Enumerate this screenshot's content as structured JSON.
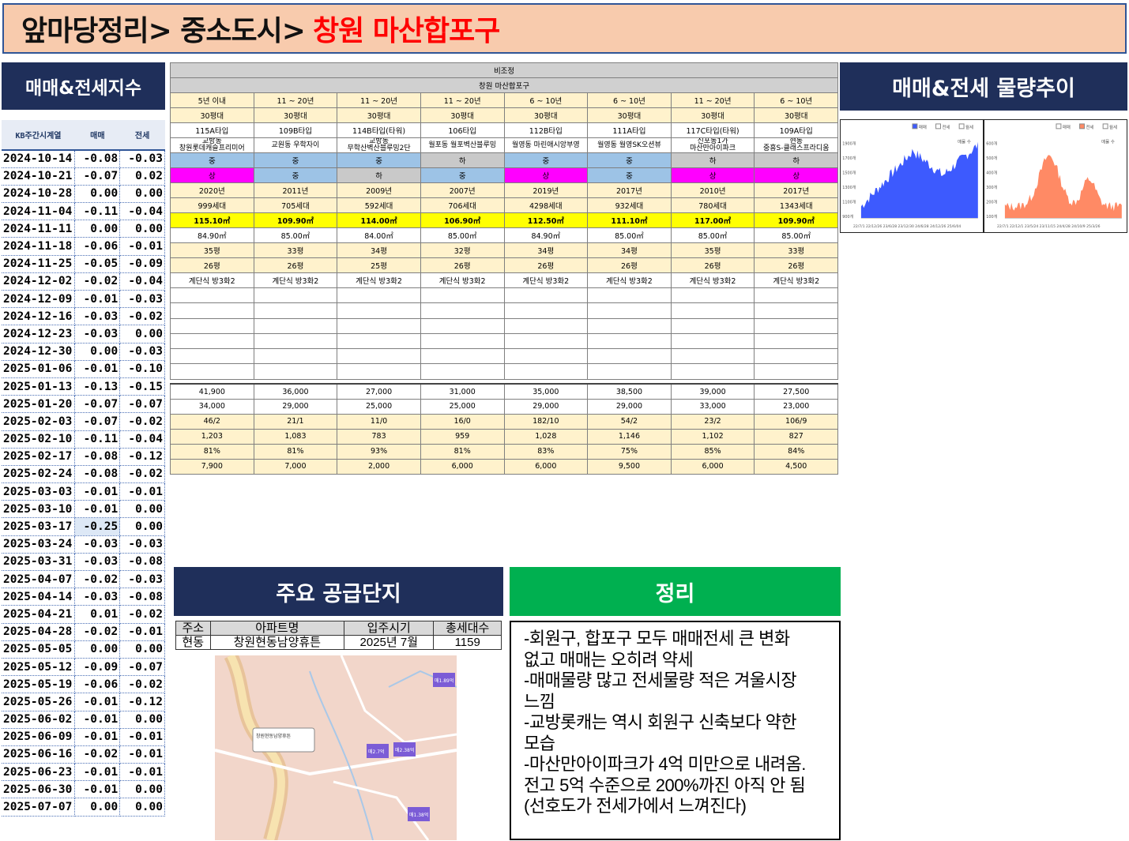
{
  "title": {
    "prefix": "앞마당정리> 중소도시>",
    "region": "창원 마산합포구"
  },
  "index": {
    "header": "매매&전세지수",
    "columns": [
      "KB주간시계열",
      "매매",
      "전세"
    ],
    "rows": [
      [
        "2024-10-14",
        "-0.08",
        "-0.03"
      ],
      [
        "2024-10-21",
        "-0.07",
        "0.02"
      ],
      [
        "2024-10-28",
        "0.00",
        "0.00"
      ],
      [
        "2024-11-04",
        "-0.11",
        "-0.04"
      ],
      [
        "2024-11-11",
        "0.00",
        "0.00"
      ],
      [
        "2024-11-18",
        "-0.06",
        "-0.01"
      ],
      [
        "2024-11-25",
        "-0.05",
        "-0.09"
      ],
      [
        "2024-12-02",
        "-0.02",
        "-0.04"
      ],
      [
        "2024-12-09",
        "-0.01",
        "-0.03"
      ],
      [
        "2024-12-16",
        "-0.03",
        "-0.02"
      ],
      [
        "2024-12-23",
        "-0.03",
        "0.00"
      ],
      [
        "2024-12-30",
        "0.00",
        "-0.03"
      ],
      [
        "2025-01-06",
        "-0.01",
        "-0.10"
      ],
      [
        "2025-01-13",
        "-0.13",
        "-0.15"
      ],
      [
        "2025-01-20",
        "-0.07",
        "-0.07"
      ],
      [
        "2025-02-03",
        "-0.07",
        "-0.02"
      ],
      [
        "2025-02-10",
        "-0.11",
        "-0.04"
      ],
      [
        "2025-02-17",
        "-0.08",
        "-0.12"
      ],
      [
        "2025-02-24",
        "-0.08",
        "-0.02"
      ],
      [
        "2025-03-03",
        "-0.01",
        "-0.01"
      ],
      [
        "2025-03-10",
        "-0.01",
        "0.00"
      ],
      [
        "2025-03-17",
        "-0.25",
        "0.00"
      ],
      [
        "2025-03-24",
        "-0.03",
        "-0.03"
      ],
      [
        "2025-03-31",
        "-0.03",
        "-0.08"
      ],
      [
        "2025-04-07",
        "-0.02",
        "-0.03"
      ],
      [
        "2025-04-14",
        "-0.03",
        "-0.08"
      ],
      [
        "2025-04-21",
        "0.01",
        "-0.02"
      ],
      [
        "2025-04-28",
        "-0.02",
        "-0.01"
      ],
      [
        "2025-05-05",
        "0.00",
        "0.00"
      ],
      [
        "2025-05-12",
        "-0.09",
        "-0.07"
      ],
      [
        "2025-05-19",
        "-0.06",
        "-0.02"
      ],
      [
        "2025-05-26",
        "-0.01",
        "-0.12"
      ],
      [
        "2025-06-02",
        "-0.01",
        "0.00"
      ],
      [
        "2025-06-09",
        "-0.01",
        "-0.01"
      ],
      [
        "2025-06-16",
        "-0.02",
        "-0.01"
      ],
      [
        "2025-06-23",
        "-0.01",
        "-0.01"
      ],
      [
        "2025-06-30",
        "-0.01",
        "0.00"
      ],
      [
        "2025-07-07",
        "0.00",
        "0.00"
      ]
    ]
  },
  "grid": {
    "adjust": "비조정",
    "region": "창원 마산합포구",
    "age": [
      "5년 이내",
      "11 ~ 20년",
      "11 ~ 20년",
      "11 ~ 20년",
      "6 ~ 10년",
      "6 ~ 10년",
      "11 ~ 20년",
      "6 ~ 10년"
    ],
    "size": [
      "30평대",
      "30평대",
      "30평대",
      "30평대",
      "30평대",
      "30평대",
      "30평대",
      "30평대"
    ],
    "type": [
      "115A타입",
      "109B타입",
      "114B타입(타워)",
      "106타입",
      "112B타입",
      "111A타입",
      "117C타입(타워)",
      "109A타입"
    ],
    "apt": [
      [
        "교방동",
        "창원롯데캐슬프리미어"
      ],
      [
        "교원동 우학자이",
        ""
      ],
      [
        "교방동",
        "무학산벽산블루밍2단"
      ],
      [
        "월포동 월포벽산블루밍",
        ""
      ],
      [
        "월영동 마린애시앙부영",
        ""
      ],
      [
        "월영동 월영SK오션뷰",
        ""
      ],
      [
        "신포동1가",
        "마산만아이파크"
      ],
      [
        "현동",
        "중흥S-클래스프라디움"
      ]
    ],
    "grade1": [
      "중",
      "중",
      "중",
      "하",
      "중",
      "중",
      "하",
      "하"
    ],
    "grade2": [
      "상",
      "중",
      "하",
      "중",
      "상",
      "중",
      "상",
      "상"
    ],
    "year": [
      "2020년",
      "2011년",
      "2009년",
      "2007년",
      "2019년",
      "2017년",
      "2010년",
      "2017년"
    ],
    "households": [
      "999세대",
      "705세대",
      "592세대",
      "706세대",
      "4298세대",
      "932세대",
      "780세대",
      "1343세대"
    ],
    "supply_area": [
      "115.10㎡",
      "109.90㎡",
      "114.00㎡",
      "106.90㎡",
      "112.50㎡",
      "111.10㎡",
      "117.00㎡",
      "109.90㎡"
    ],
    "exclusive_area": [
      "84.90㎡",
      "85.00㎡",
      "84.00㎡",
      "85.00㎡",
      "84.90㎡",
      "85.00㎡",
      "85.00㎡",
      "85.00㎡"
    ],
    "pyeong_supply": [
      "35평",
      "33평",
      "34평",
      "32평",
      "34평",
      "34평",
      "35평",
      "33평"
    ],
    "pyeong_excl": [
      "26평",
      "26평",
      "25평",
      "26평",
      "26평",
      "26평",
      "26평",
      "26평"
    ],
    "structure": [
      "계단식 방3화2",
      "계단식 방3화2",
      "계단식 방3화2",
      "계단식 방3화2",
      "계단식 방3화2",
      "계단식 방3화2",
      "계단식 방3화2",
      "계단식 방3화2"
    ],
    "sale": [
      "41,900",
      "36,000",
      "27,000",
      "31,000",
      "35,000",
      "38,500",
      "39,000",
      "27,500"
    ],
    "jeonse": [
      "34,000",
      "29,000",
      "25,000",
      "25,000",
      "29,000",
      "29,000",
      "33,000",
      "23,000"
    ],
    "listings": [
      "46/2",
      "21/1",
      "11/0",
      "16/0",
      "182/10",
      "54/2",
      "23/2",
      "106/9"
    ],
    "per_pyeong": [
      "1,203",
      "1,083",
      "783",
      "959",
      "1,028",
      "1,146",
      "1,102",
      "827"
    ],
    "ratio": [
      "81%",
      "81%",
      "93%",
      "81%",
      "83%",
      "75%",
      "85%",
      "84%"
    ],
    "gap": [
      "7,900",
      "7,000",
      "2,000",
      "6,000",
      "6,000",
      "9,500",
      "6,000",
      "4,500"
    ]
  },
  "volume": {
    "header": "매매&전세 물량추이",
    "chart1": {
      "legend": [
        "매매",
        "전세",
        "월세"
      ],
      "sublabel": "매물 수",
      "yticks": [
        "1900개",
        "1700개",
        "1500개",
        "1300개",
        "1100개",
        "900개"
      ],
      "xticks": "22/7/1  22/12/26 23/6/28 23/12/30 24/6/28 24/12/26 25/6/04",
      "color": "#3d5afe"
    },
    "chart2": {
      "legend": [
        "매매",
        "전세",
        "월세"
      ],
      "sublabel": "매물 수",
      "yticks": [
        "600개",
        "500개",
        "400개",
        "300개",
        "200개",
        "100개"
      ],
      "xticks": "22/7/1  22/12/1 23/5/24 23/11/15 24/4/28 24/10/9 25/3/26",
      "color": "#ff8a65"
    }
  },
  "supply": {
    "header": "주요 공급단지",
    "columns": [
      "주소",
      "아파트명",
      "입주시기",
      "총세대수"
    ],
    "rows": [
      [
        "현동",
        "창원현동남양휴튼",
        "2025년 7월",
        "1159"
      ]
    ],
    "map_labels": [
      "창원현동남양휴튼",
      "매1.89억",
      "매2.7억",
      "매2.38억",
      "매1.38억"
    ]
  },
  "summary": {
    "header": "정리",
    "lines": [
      "-회원구, 합포구 모두 매매전세 큰 변화",
      "없고 매매는 오히려 약세",
      "-매매물량 많고 전세물량 적은 겨울시장",
      "느낌",
      "-교방롯캐는 역시 회원구 신축보다 약한",
      "모습",
      "-마산만아이파크가 4억 미만으로 내려옴.",
      "전고 5억 수준으로 200%까진 아직 안 됨",
      "(선호도가 전세가에서 느껴진다)"
    ]
  }
}
